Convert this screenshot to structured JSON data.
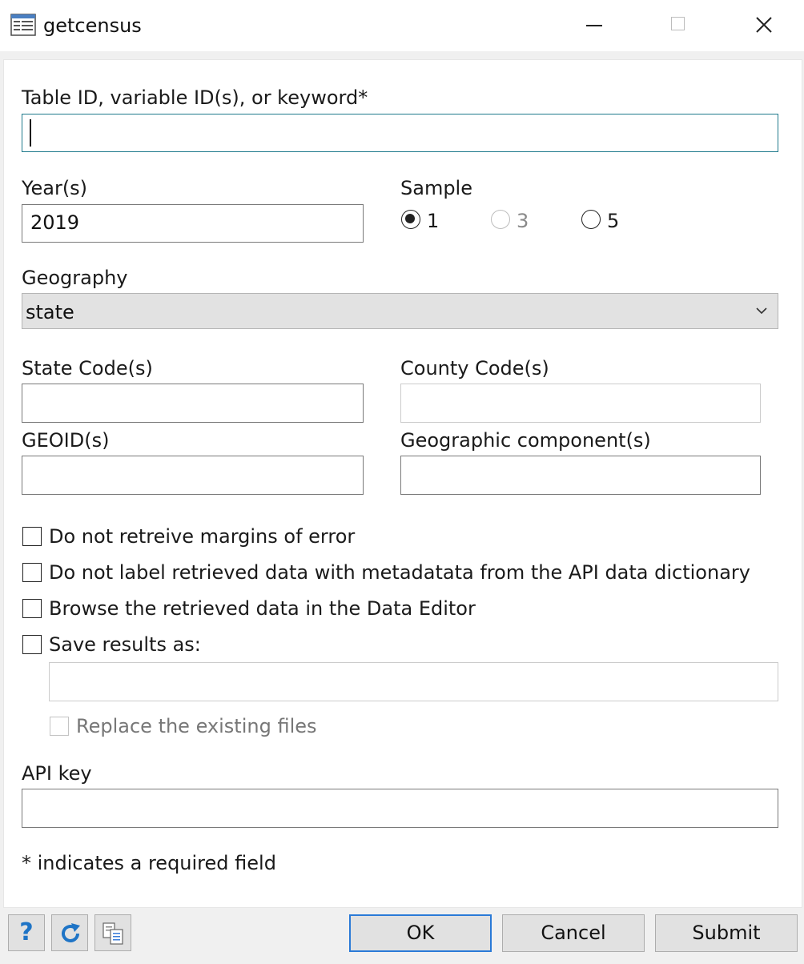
{
  "window": {
    "title": "getcensus",
    "icon": "form-window-icon"
  },
  "fields": {
    "table_id": {
      "label": "Table ID, variable ID(s), or keyword*",
      "value": ""
    },
    "years": {
      "label": "Year(s)",
      "value": "2019"
    },
    "sample": {
      "label": "Sample",
      "options": [
        {
          "label": "1",
          "checked": true,
          "enabled": true
        },
        {
          "label": "3",
          "checked": false,
          "enabled": false
        },
        {
          "label": "5",
          "checked": false,
          "enabled": true
        }
      ]
    },
    "geography": {
      "label": "Geography",
      "value": "state"
    },
    "state_codes": {
      "label": "State Code(s)",
      "value": ""
    },
    "county_codes": {
      "label": "County Code(s)",
      "value": ""
    },
    "geoids": {
      "label": "GEOID(s)",
      "value": ""
    },
    "geo_components": {
      "label": "Geographic component(s)",
      "value": ""
    }
  },
  "options": {
    "no_moe": "Do not retreive margins of error",
    "no_label": "Do not label retrieved data with metadatata from the API data dictionary",
    "browse": "Browse the retrieved data in the Data Editor",
    "save_as": "Save results as:",
    "replace": "Replace the existing files"
  },
  "save_path": {
    "value": ""
  },
  "api_key": {
    "label": "API key",
    "value": ""
  },
  "note": "* indicates a required field",
  "buttons": {
    "ok": "OK",
    "cancel": "Cancel",
    "submit": "Submit"
  },
  "toolbar": {
    "help_glyph": "?",
    "icons": [
      "help-icon",
      "reset-icon",
      "copy-command-icon"
    ]
  },
  "colors": {
    "focus_border": "#1f7a8c",
    "accent": "#1e74c6",
    "default_button_border": "#2a7ad7"
  }
}
